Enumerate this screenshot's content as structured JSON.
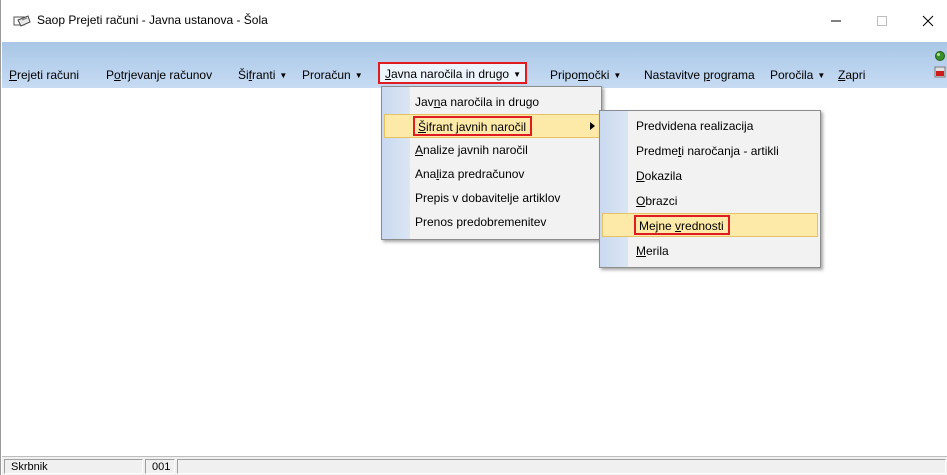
{
  "window": {
    "title": "Saop Prejeti računi - Javna ustanova - Šola",
    "controls": {
      "minimize": "—",
      "maximize": "☐",
      "close": "✕"
    }
  },
  "menubar": {
    "items": [
      {
        "label": "Prejeti računi",
        "has_caret": false
      },
      {
        "label": "Potrjevanje računov",
        "has_caret": false
      },
      {
        "label": "Šifranti",
        "has_caret": true
      },
      {
        "label": "Proračun",
        "has_caret": true
      },
      {
        "label": "Javna naročila in drugo",
        "has_caret": true,
        "active": true
      },
      {
        "label": "Pripomočki",
        "has_caret": true
      },
      {
        "label": "Nastavitve programa",
        "has_caret": false
      },
      {
        "label": "Poročila",
        "has_caret": true
      },
      {
        "label": "Zapri",
        "has_caret": false
      }
    ],
    "caret_glyph": "▼"
  },
  "dropdown_main": {
    "items": [
      {
        "label": "Javna naročila in drugo"
      },
      {
        "label": "Šifrant javnih naročil",
        "highlighted": true,
        "has_submenu": true
      },
      {
        "label": "Analize javnih naročil"
      },
      {
        "label": "Analiza predračunov"
      },
      {
        "label": "Prepis v dobavitelje artiklov"
      },
      {
        "label": "Prenos predobremenitev"
      }
    ]
  },
  "dropdown_sub": {
    "items": [
      {
        "label": "Predvidena realizacija"
      },
      {
        "label": "Predmeti naročanja - artikli"
      },
      {
        "label": "Dokazila"
      },
      {
        "label": "Obrazci"
      },
      {
        "label": "Mejne vrednosti",
        "highlighted": true
      },
      {
        "label": "Merila"
      }
    ]
  },
  "statusbar": {
    "user": "Skrbnik",
    "code": "001",
    "extra": ""
  },
  "colors": {
    "menubar_gradient": [
      "#a9c6e6",
      "#c7dbf2"
    ],
    "highlight_border": "#e11b22",
    "hover_fill": "#fde9a8"
  }
}
